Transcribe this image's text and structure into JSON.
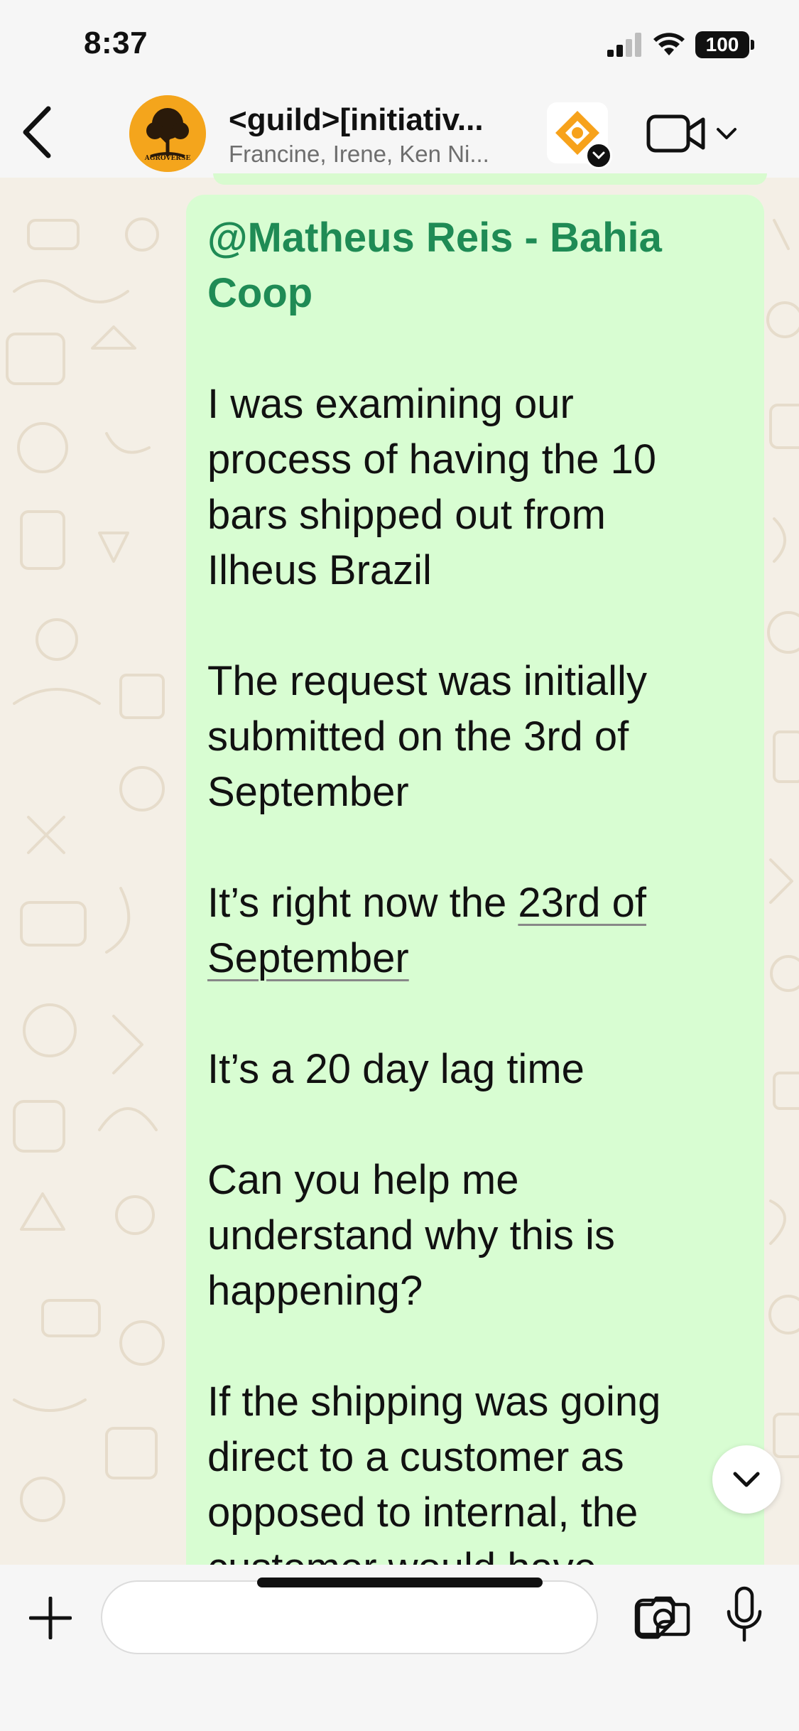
{
  "status_bar": {
    "time": "8:37",
    "battery": "100"
  },
  "header": {
    "title": "<guild>[initiativ...",
    "subtitle": "Francine, Irene, Ken Ni...",
    "avatar_text": "AGROVERSE"
  },
  "message": {
    "mention": "@Matheus Reis - Bahia Coop",
    "paragraphs": [
      [
        "I was examining our",
        "process of having the 10",
        "bars shipped out from",
        "Ilheus Brazil"
      ],
      [
        "The request was initially",
        "submitted on the 3rd of",
        "September"
      ],
      [
        "It’s right now the 23rd of",
        "September"
      ],
      [
        "It’s a 20 day lag time"
      ],
      [
        "Can you help me",
        "understand why this is",
        "happening?"
      ],
      [
        "If the shipping was going",
        "direct to a customer as",
        "opposed to internal, the",
        "customer would have"
      ]
    ],
    "p1_l1": "I was examining our",
    "p1_l2": "process of having the 10",
    "p1_l3": "bars shipped out from",
    "p1_l4": "Ilheus Brazil",
    "p2_l1": "The request was initially",
    "p2_l2": "submitted on the 3rd of",
    "p2_l3": "September",
    "p3_l1_prefix": "It’s right now the ",
    "p3_l1_link": "23rd of",
    "p3_l2_link": "September",
    "p4_l1": "It’s a 20 day lag time",
    "p5_l1": "Can you help me",
    "p5_l2": "understand why this is",
    "p5_l3": "happening?",
    "p6_l1": "If the shipping was going",
    "p6_l2": "direct to a customer as",
    "p6_l3": "opposed to internal, the",
    "p6_l4": "customer would have"
  },
  "colors": {
    "bubble": "#d8fdd2",
    "mention": "#1f8b55",
    "avatar": "#f4a51c",
    "wallpaper": "#f4efe6"
  },
  "icons": [
    "back-chevron-icon",
    "video-camera-icon",
    "chevron-down-icon",
    "plus-icon",
    "sticker-icon",
    "camera-icon",
    "microphone-icon",
    "scroll-down-chevron-icon"
  ]
}
